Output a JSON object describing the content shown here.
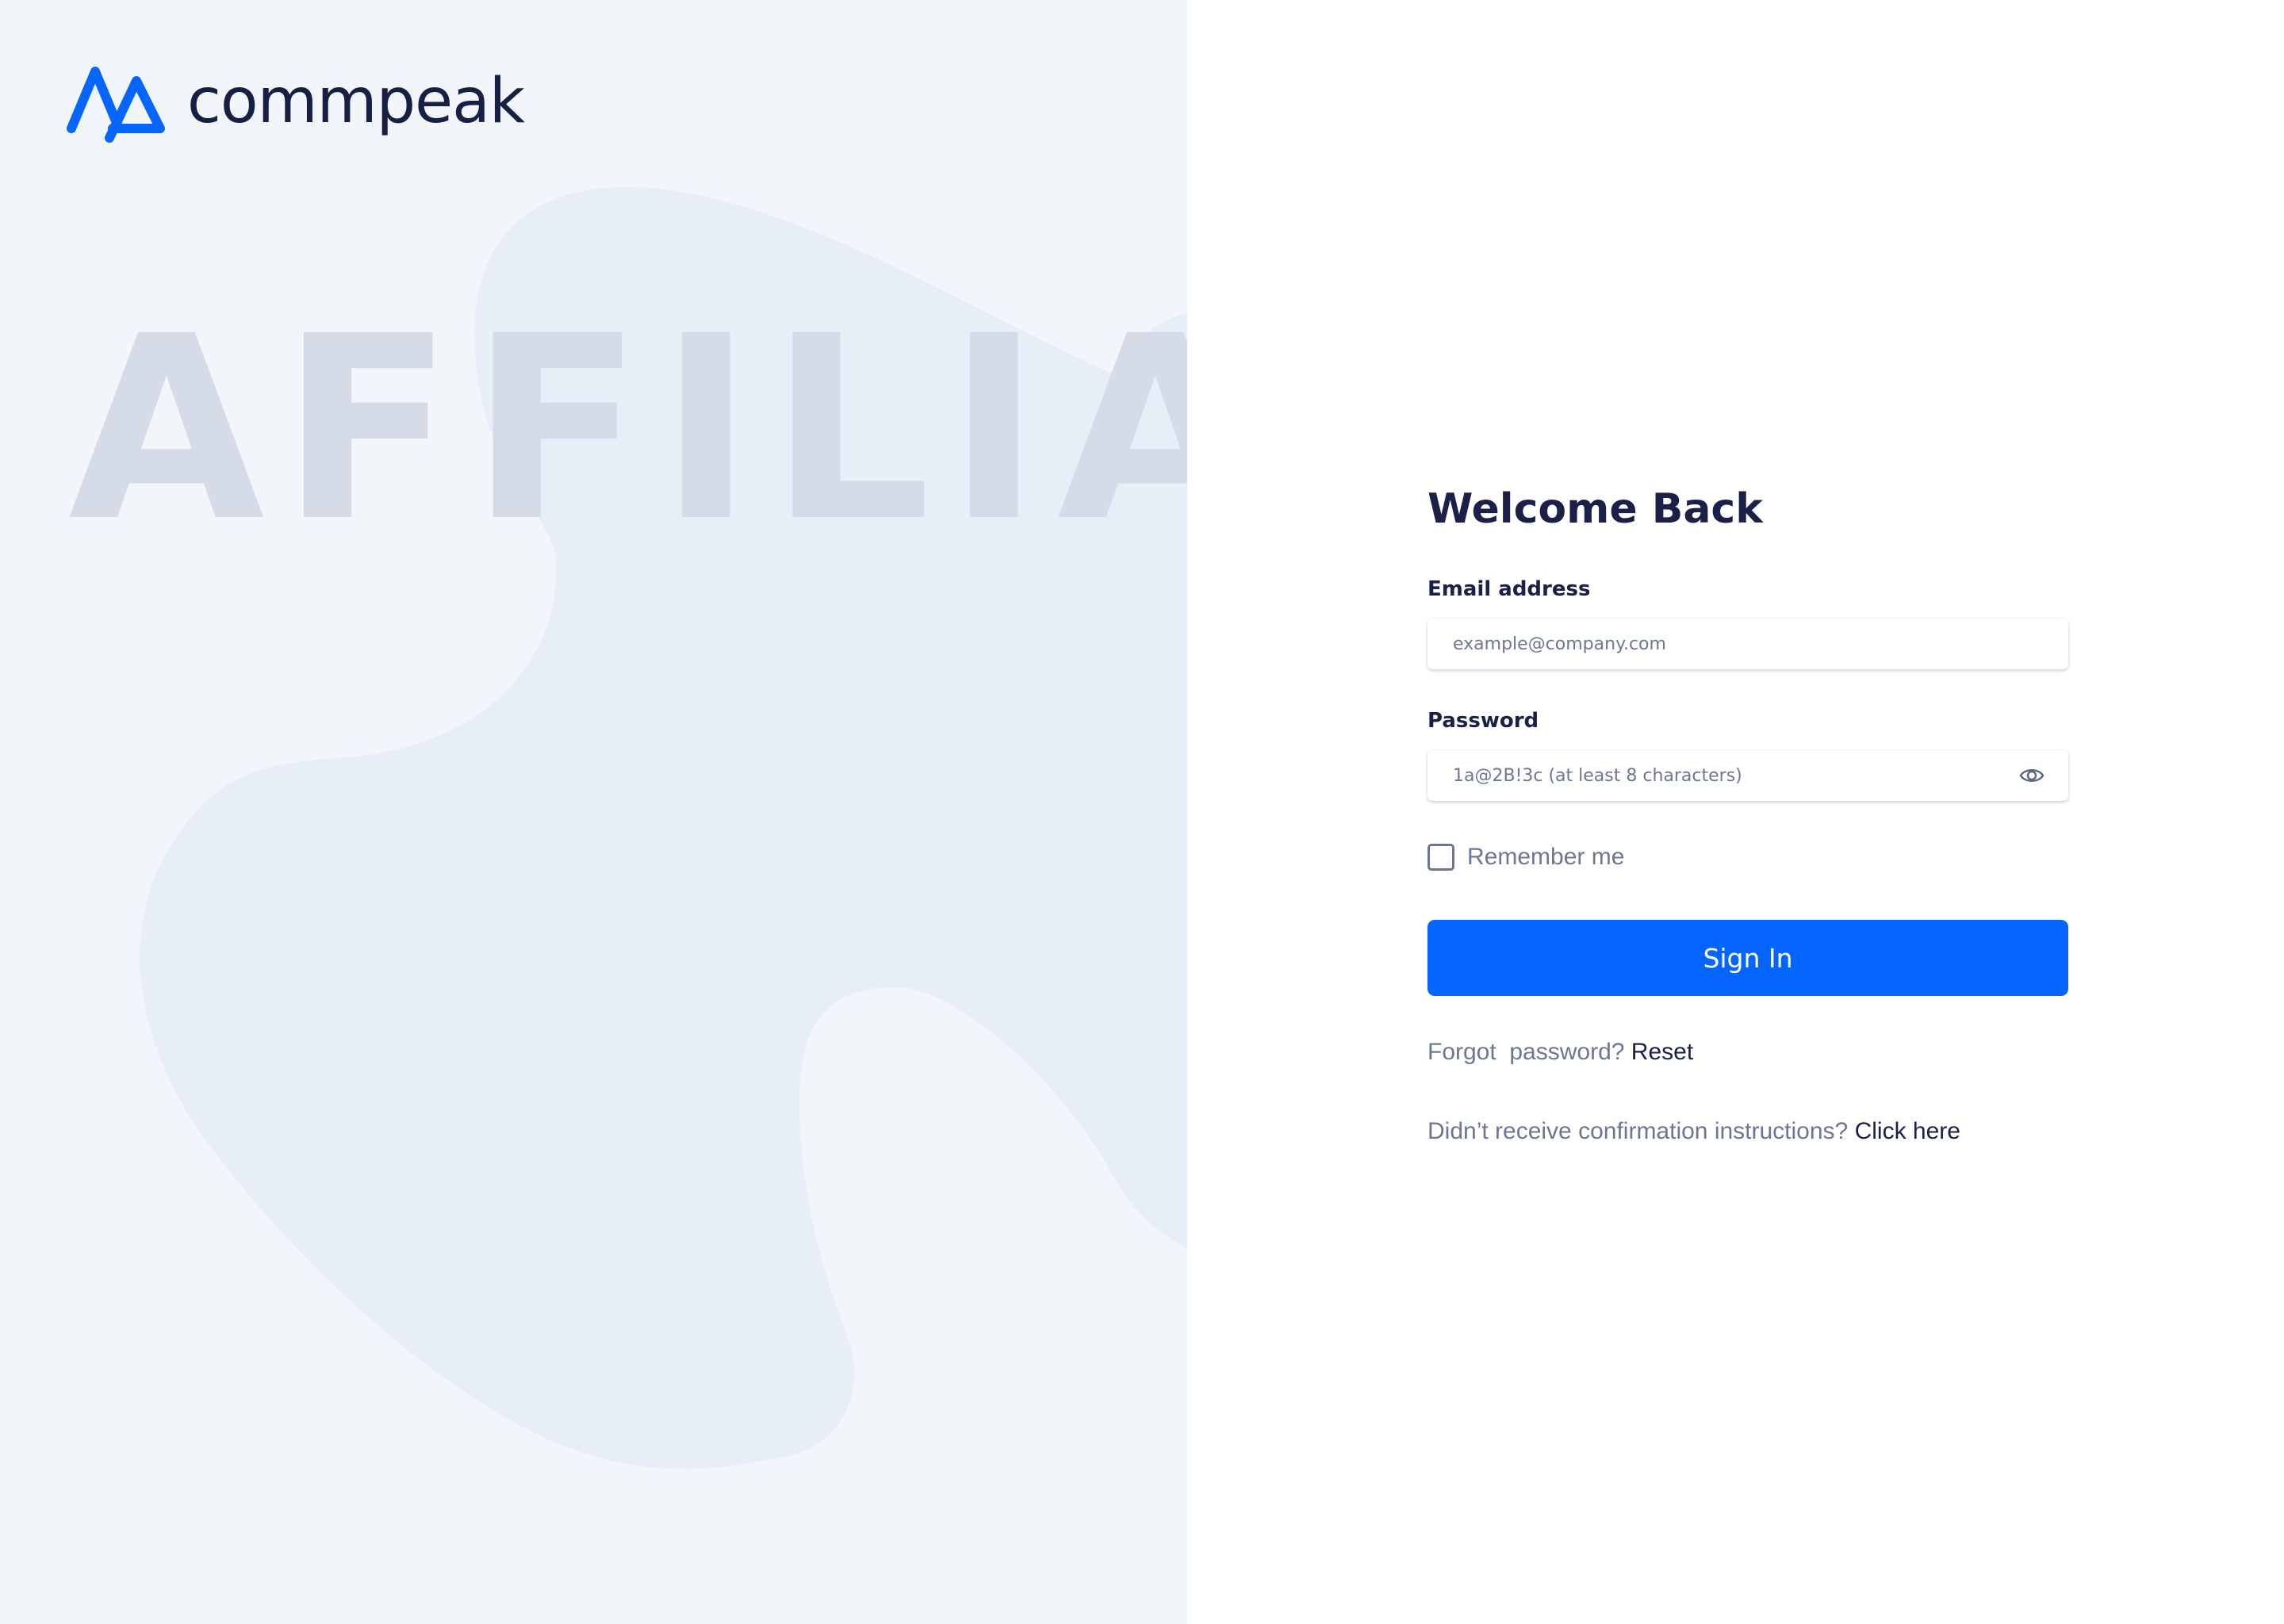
{
  "brand": {
    "name": "commpeak",
    "logo_icon": "commpeak-logo-icon",
    "watermark": "AFFILIATE",
    "colors": {
      "primary": "#0565ff",
      "navy": "#1b2049",
      "muted": "#6d7793",
      "left_background": "#f2f5f9",
      "blob": "#e8eef8",
      "watermark": "#d5dbe7"
    }
  },
  "login": {
    "title": "Welcome Back",
    "email": {
      "label": "Email address",
      "placeholder": "example@company.com",
      "value": ""
    },
    "password": {
      "label": "Password",
      "placeholder": "1a@2B!3c (at least 8 characters)",
      "value": "",
      "toggle_icon": "eye-icon"
    },
    "remember": {
      "label": "Remember me",
      "checked": false
    },
    "submit_label": "Sign In",
    "forgot": {
      "text": "Forgot  password?",
      "link": "Reset"
    },
    "confirmation": {
      "text": "Didn’t receive confirmation instructions?",
      "link": "Click here"
    }
  }
}
